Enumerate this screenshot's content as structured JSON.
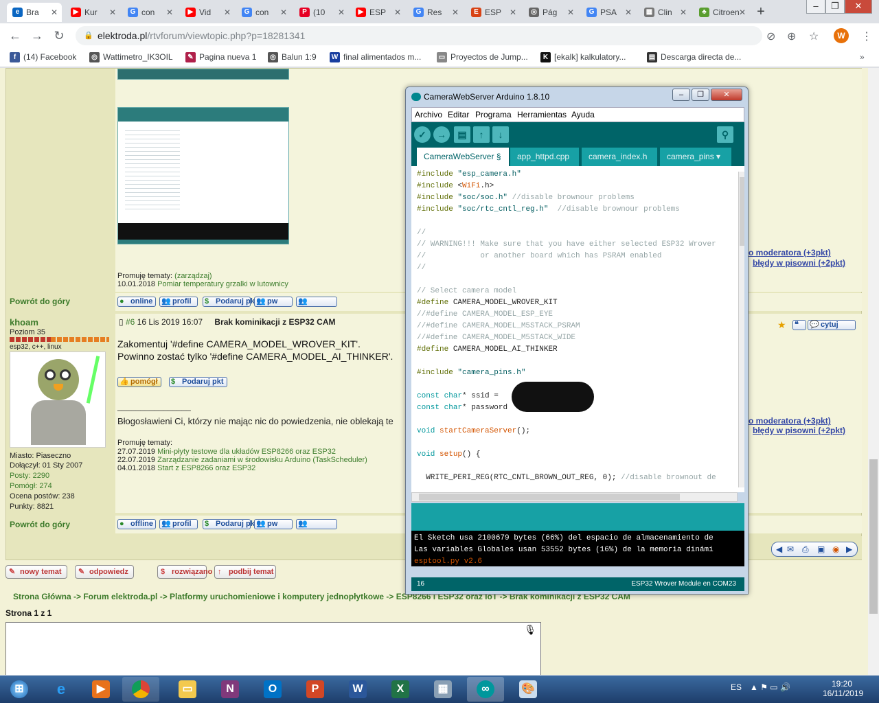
{
  "tabs": [
    {
      "label": "Bra",
      "fav": "e",
      "color": "#0a66c2"
    },
    {
      "label": "Kur",
      "fav": "▶",
      "color": "#ff0000"
    },
    {
      "label": "con",
      "fav": "G",
      "color": "#4285f4"
    },
    {
      "label": "Vid",
      "fav": "▶",
      "color": "#ff0000"
    },
    {
      "label": "con",
      "fav": "G",
      "color": "#4285f4"
    },
    {
      "label": "(10",
      "fav": "P",
      "color": "#e60023"
    },
    {
      "label": "ESP",
      "fav": "▶",
      "color": "#ff0000"
    },
    {
      "label": "Res",
      "fav": "G",
      "color": "#4285f4"
    },
    {
      "label": "ESP",
      "fav": "E",
      "color": "#d84315"
    },
    {
      "label": "Pág",
      "fav": "◎",
      "color": "#666666"
    },
    {
      "label": "PSA",
      "fav": "G",
      "color": "#4285f4"
    },
    {
      "label": "Clin",
      "fav": "▦",
      "color": "#777777"
    },
    {
      "label": "Citroen",
      "fav": "♣",
      "color": "#5a9e2f"
    }
  ],
  "url": {
    "host": "elektroda.pl",
    "path": "/rtvforum/viewtopic.php?p=18281341"
  },
  "profile_initial": "W",
  "bookmarks": [
    {
      "label": "(14) Facebook",
      "icon": "f",
      "color": "#3b5998"
    },
    {
      "label": "Wattimetro_IK3OIL",
      "icon": "◎",
      "color": "#555555"
    },
    {
      "label": "Pagina nueva 1",
      "icon": "✎",
      "color": "#b0204a"
    },
    {
      "label": "Balun 1:9",
      "icon": "◎",
      "color": "#555555"
    },
    {
      "label": "final alimentados m...",
      "icon": "W",
      "color": "#1a3fa0"
    },
    {
      "label": "Proyectos de Jump...",
      "icon": "▭",
      "color": "#888888"
    },
    {
      "label": "[ekalk] kalkulatory...",
      "icon": "K",
      "color": "#111111"
    },
    {
      "label": "Descarga directa de...",
      "icon": "▤",
      "color": "#333333"
    }
  ],
  "post1": {
    "promote": "Promuję tematy:",
    "promote_link": "(zarządzaj)",
    "date": "10.01.2018",
    "topic": "Pomiar temperatury grzalki w lutownicy",
    "back": "Powrót do góry",
    "buttons": [
      "online",
      "profil",
      "Podaruj pkt",
      "pw",
      ""
    ]
  },
  "user": {
    "name": "khoam",
    "level": "Poziom 35",
    "skills": "esp32, c++, linux",
    "city": "Miasto: Piaseczno",
    "joined": "Dołączył: 01 Sty 2007",
    "posts": "Posty: 2290",
    "helped": "Pomógł: 274",
    "rating": "Ocena postów: 238",
    "points": "Punkty: 8821"
  },
  "post2": {
    "num": "#6",
    "date": "16 Lis 2019 16:07",
    "title": "Brak kominikacji z ESP32 CAM",
    "line1": "Zakomentuj '#define CAMERA_MODEL_WROVER_KIT'.",
    "line2": "Powinno zostać tylko '#define CAMERA_MODEL_AI_THINKER'.",
    "helped_btn": "pomógł",
    "give_btn": "Podaruj pkt",
    "signature_line": "________________",
    "signature": "Błogosławieni Ci, którzy nie mając nic do powiedzenia, nie oblekają te",
    "promote": "Promuję tematy:",
    "topics": [
      {
        "date": "27.07.2019",
        "title": "Mini-płyty testowe dla układów ESP8266 oraz ESP32"
      },
      {
        "date": "22.07.2019",
        "title": "Zarządzanie zadaniami w środowisku Arduino (TaskScheduler)"
      },
      {
        "date": "04.01.2018",
        "title": "Start z ESP8266 oraz ESP32"
      }
    ],
    "quote": "cytuj",
    "back": "Powrót do góry",
    "buttons": [
      "offline",
      "profil",
      "Podaruj pkt",
      "pw",
      ""
    ]
  },
  "mod": {
    "note": "o moderatora (+3pkt)",
    "spell": "błędy w pisowni (+2pkt)"
  },
  "actions": [
    "nowy temat",
    "odpowiedz",
    "rozwiązano",
    "podbij temat"
  ],
  "breadcrumb": "Strona Główna -> Forum elektroda.pl -> Platformy uruchomieniowe i komputery jednopłytkowe -> ESP8266 i ESP32 oraz IoT -> Brak kominikacji z ESP32 CAM",
  "page": "Strona 1 z 1",
  "ide": {
    "title": "CameraWebServer Arduino 1.8.10",
    "menus": [
      "Archivo",
      "Editar",
      "Programa",
      "Herramientas",
      "Ayuda"
    ],
    "tabs": [
      "CameraWebServer §",
      "app_httpd.cpp",
      "camera_index.h",
      "camera_pins"
    ],
    "code": [
      "#include \"esp_camera.h\"",
      "#include <WiFi.h>",
      "#include \"soc/soc.h\" //disable brownour problems",
      "#include \"soc/rtc_cntl_reg.h\"  //disable brownour problems",
      "",
      "//",
      "// WARNING!!! Make sure that you have either selected ESP32 Wrover",
      "//            or another board which has PSRAM enabled",
      "//",
      "",
      "// Select camera model",
      "#define CAMERA_MODEL_WROVER_KIT",
      "//#define CAMERA_MODEL_ESP_EYE",
      "//#define CAMERA_MODEL_M5STACK_PSRAM",
      "//#define CAMERA_MODEL_M5STACK_WIDE",
      "#define CAMERA_MODEL_AI_THINKER",
      "",
      "#include \"camera_pins.h\"",
      "",
      "const char* ssid = ",
      "const char* password",
      "",
      "void startCameraServer();",
      "",
      "void setup() {",
      "",
      "  WRITE_PERI_REG(RTC_CNTL_BROWN_OUT_REG, 0); //disable brownout de"
    ],
    "console": [
      "El Sketch usa 2100679 bytes (66%) del espacio de almacenamiento de",
      "Las variables Globales usan 53552 bytes (16%) de la memoria dinámi",
      "esptool.py v2.6"
    ],
    "line_num": "16",
    "board": "ESP32 Wrover Module en COM23"
  },
  "taskbar": {
    "lang": "ES",
    "time": "19:20",
    "date": "16/11/2019"
  }
}
